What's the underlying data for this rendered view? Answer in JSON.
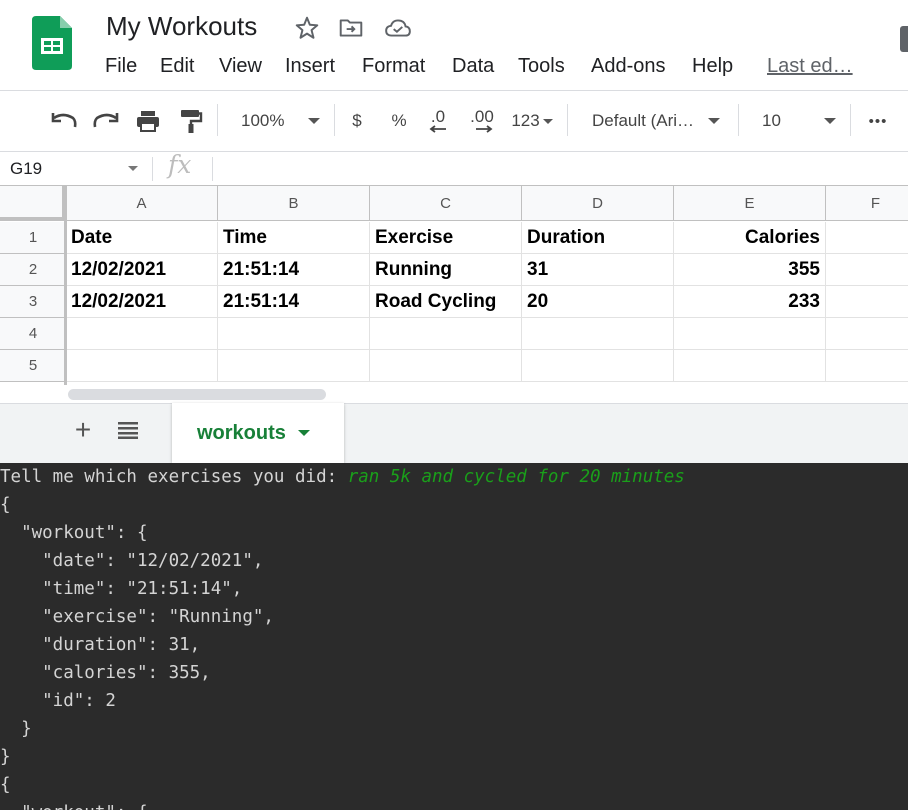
{
  "header": {
    "title": "My Workouts",
    "icons": [
      "star-icon",
      "move-to-folder-icon",
      "cloud-status-icon"
    ],
    "menu": [
      "File",
      "Edit",
      "View",
      "Insert",
      "Format",
      "Data",
      "Tools",
      "Add-ons",
      "Help"
    ],
    "last_edit": "Last ed…"
  },
  "toolbar": {
    "zoom": "100%",
    "currency": "$",
    "percent": "%",
    "decrease_decimal": ".0",
    "increase_decimal": ".00",
    "number_format": "123",
    "font": "Default (Ari…",
    "font_size": "10",
    "more": "•••"
  },
  "formula_bar": {
    "cell_ref": "G19",
    "fx": "fx",
    "value": ""
  },
  "grid": {
    "columns": [
      "A",
      "B",
      "C",
      "D",
      "E",
      "F"
    ],
    "rows": [
      "1",
      "2",
      "3",
      "4",
      "5"
    ],
    "cells": [
      [
        "Date",
        "Time",
        "Exercise",
        "Duration",
        "Calories"
      ],
      [
        "12/02/2021",
        "21:51:14",
        "Running",
        "31",
        "355"
      ],
      [
        "12/02/2021",
        "21:51:14",
        "Road Cycling",
        "20",
        "233"
      ],
      [
        "",
        "",
        "",
        "",
        ""
      ],
      [
        "",
        "",
        "",
        "",
        ""
      ]
    ]
  },
  "sheet_tabs": {
    "add": "+",
    "list": "≡",
    "active": "workouts"
  },
  "terminal": {
    "prompt": "Tell me which exercises you did: ",
    "input": "ran 5k and cycled for 20 minutes",
    "lines": [
      "{",
      "  \"workout\": {",
      "    \"date\": \"12/02/2021\",",
      "    \"time\": \"21:51:14\",",
      "    \"exercise\": \"Running\",",
      "    \"duration\": 31,",
      "    \"calories\": 355,",
      "    \"id\": 2",
      "  }",
      "}",
      "{",
      "  \"workout\": {"
    ]
  },
  "colors": {
    "sheets_green": "#0f9d58",
    "tab_green": "#188038",
    "terminal_bg": "#2b2b2b",
    "terminal_green": "#1a9f1a"
  }
}
